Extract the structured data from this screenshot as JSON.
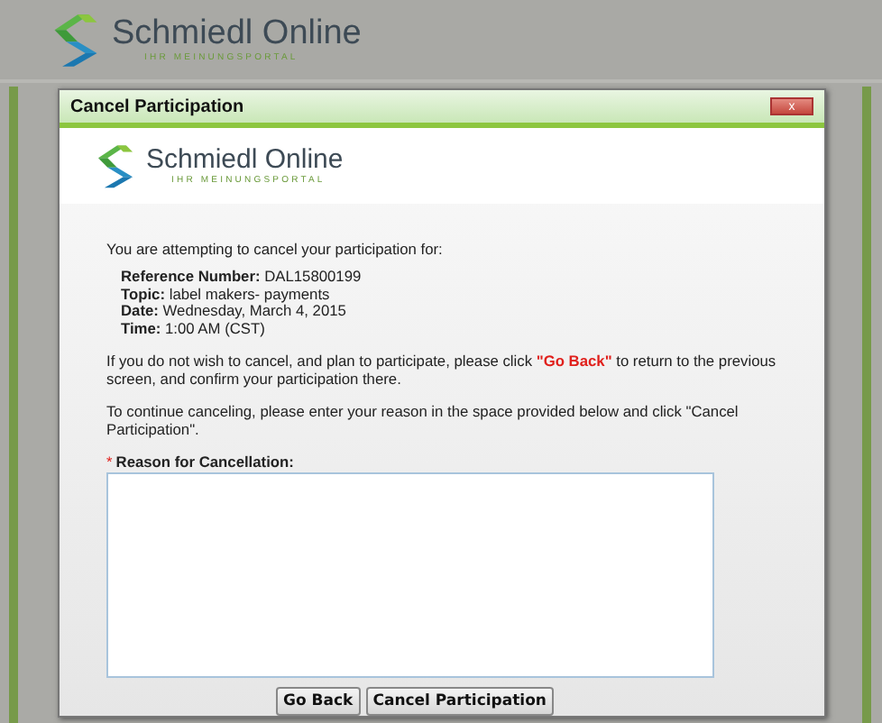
{
  "header": {
    "brand": "Schmiedl Online",
    "tagline": "IHR MEINUNGSPORTAL"
  },
  "dialog": {
    "title": "Cancel Participation",
    "close": "x",
    "logo": {
      "brand": "Schmiedl Online",
      "tagline": "IHR MEINUNGSPORTAL"
    },
    "intro": "You are attempting to cancel your participation for:",
    "details": [
      {
        "label": "Reference Number:",
        "value": "DAL15800199"
      },
      {
        "label": "Topic:",
        "value": "label makers- payments"
      },
      {
        "label": "Date:",
        "value": "Wednesday, March 4, 2015"
      },
      {
        "label": "Time:",
        "value": "1:00 AM (CST)"
      }
    ],
    "go_back_note": {
      "before": "If you do not wish to cancel, and plan to participate, please click ",
      "emphasis": "\"Go Back\"",
      "after": " to return to the previous screen, and confirm your participation there."
    },
    "continue_note": "To continue canceling, please enter your reason in the space provided below and click \"Cancel Participation\".",
    "reason": {
      "required_mark": "*",
      "label": "Reason for Cancellation:"
    },
    "buttons": [
      "Go Back",
      "Cancel Participation"
    ]
  }
}
